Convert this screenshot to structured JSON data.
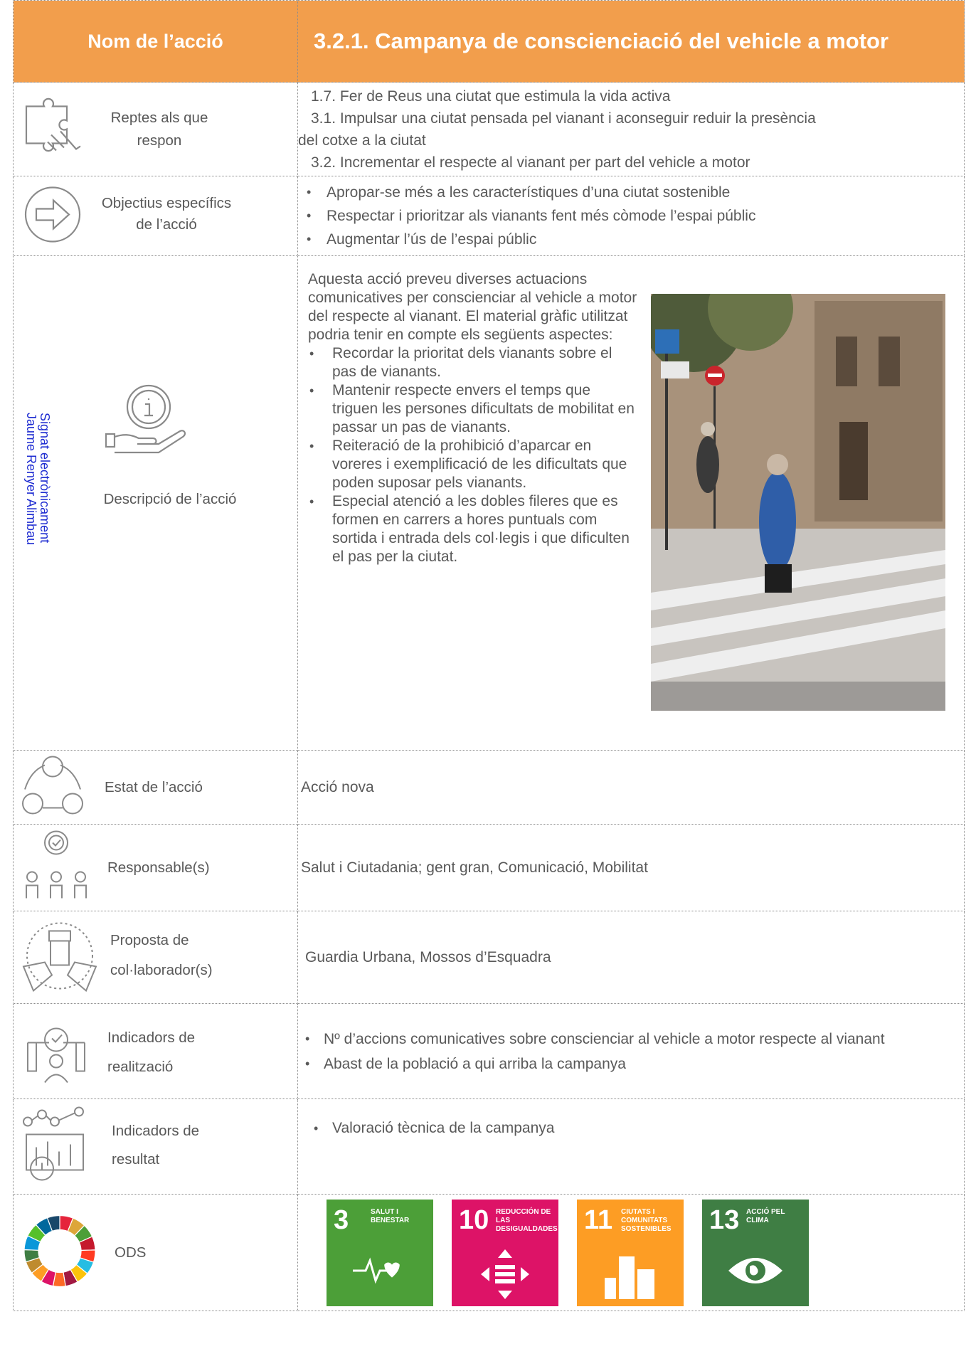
{
  "header": {
    "left": "Nom de l’acció",
    "right": "3.2.1. Campanya de conscienciació del vehicle a motor"
  },
  "side_stamp": {
    "line1": "Signat electrònicament",
    "line2": "Jaume Renyer Alimbau"
  },
  "rows": {
    "reptes": {
      "label_line1": "Reptes als que",
      "label_line2": "respon",
      "items": [
        "1.7. Fer de Reus una ciutat que estimula la vida activa",
        "3.1. Impulsar una ciutat pensada pel vianant i aconseguir reduir la presència",
        "del cotxe a la ciutat",
        "3.2. Incrementar el respecte al vianant per part del vehicle a motor"
      ]
    },
    "objectius": {
      "label_line1": "Objectius específics",
      "label_line2": "de l’acció",
      "items": [
        "Apropar-se més a les característiques d’una ciutat sostenible",
        "Respectar i prioritzar als vianants fent més còmode l’espai públic",
        "Augmentar l’ús de l’espai públic"
      ]
    },
    "descripcio": {
      "label": "Descripció de l’acció",
      "intro": "Aquesta acció preveu diverses actuacions comunicatives per conscienciar al vehicle a motor del respecte al vianant. El material gràfic utilitzat podria tenir en compte els següents aspectes:",
      "items": [
        "Recordar la prioritat dels vianants sobre el pas de vianants.",
        "Mantenir respecte envers el temps que triguen les persones dificultats de mobilitat en passar un pas de vianants.",
        "Reiteració de la prohibició d’aparcar en voreres i exemplificació de les dificultats que poden suposar pels vianants.",
        "Especial atenció a les dobles fileres que es formen en carrers a hores puntuals com sortida i entrada dels col·legis i que dificulten el pas per la ciutat."
      ]
    },
    "estat": {
      "label": "Estat de l’acció",
      "value": "Acció nova"
    },
    "responsable": {
      "label": "Responsable(s)",
      "value": "Salut i Ciutadania; gent gran, Comunicació, Mobilitat"
    },
    "collaboradors": {
      "label_line1": "Proposta de",
      "label_line2": "col·laborador(s)",
      "value": "Guardia Urbana, Mossos d’Esquadra"
    },
    "realitzacio": {
      "label_line1": "Indicadors de",
      "label_line2": "realització",
      "items": [
        "Nº d’accions comunicatives sobre conscienciar al vehicle a motor respecte al vianant",
        "Abast de la població a qui arriba la campanya"
      ]
    },
    "resultat": {
      "label_line1": "Indicadors de",
      "label_line2": "resultat",
      "items": [
        "Valoració tècnica de la campanya"
      ]
    },
    "ods": {
      "label": "ODS",
      "goals": [
        {
          "number": "3",
          "title": "SALUT I BENESTAR",
          "color": "#4c9f38"
        },
        {
          "number": "10",
          "title": "REDUCCIÓN DE LAS DESIGUALDADES",
          "color": "#dd1367"
        },
        {
          "number": "11",
          "title": "CIUTATS I COMUNITATS SOSTENIBLES",
          "color": "#fd9d24"
        },
        {
          "number": "13",
          "title": "ACCIÓ PEL CLIMA",
          "color": "#3f7e44"
        }
      ]
    }
  },
  "bullet_char": "•",
  "colors": {
    "header_bg": "#f29e4c",
    "text": "#595959",
    "stamp": "#1f2dd1"
  }
}
